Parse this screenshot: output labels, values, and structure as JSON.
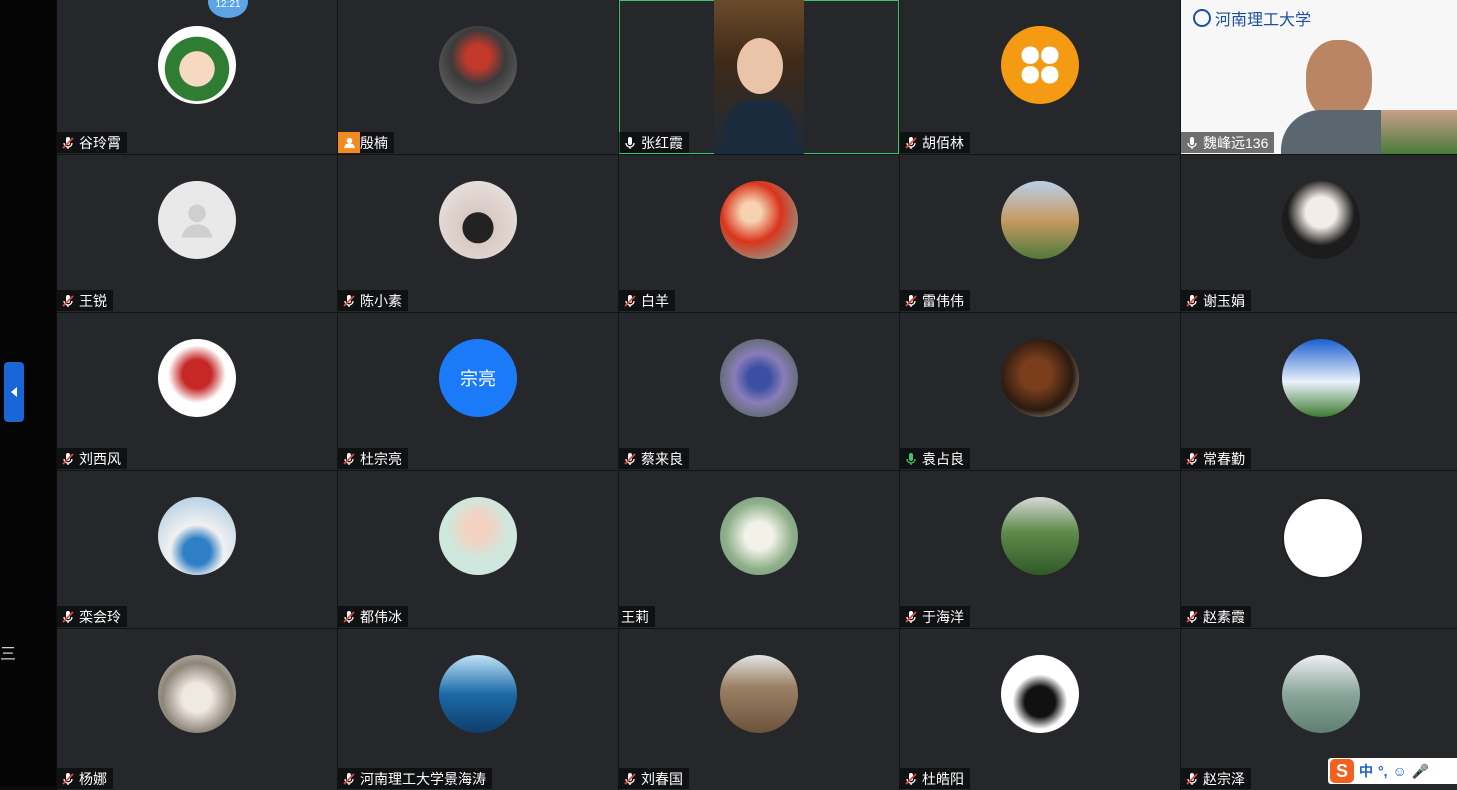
{
  "participants": [
    {
      "name": "谷玲霄",
      "mic": "muted",
      "avatar": "cartoon-girl-avatar",
      "badge_text": "12:21"
    },
    {
      "name": "殷楠",
      "mic": "user-badge",
      "avatar": "boy-photo-avatar"
    },
    {
      "name": "张红霞",
      "mic": "on",
      "avatar": "woman-video-feed"
    },
    {
      "name": "胡佰林",
      "mic": "muted",
      "avatar": "orange-clover-avatar"
    },
    {
      "name": "魏峰远136",
      "mic": "on",
      "avatar": "man-video-feed",
      "banner_text": "河南理工大学"
    },
    {
      "name": "王锐",
      "mic": "muted",
      "avatar": "default-person-avatar"
    },
    {
      "name": "陈小素",
      "mic": "muted",
      "avatar": "moon-ornament-avatar"
    },
    {
      "name": "白羊",
      "mic": "muted",
      "avatar": "red-art-avatar"
    },
    {
      "name": "雷伟伟",
      "mic": "muted",
      "avatar": "castle-landscape-avatar"
    },
    {
      "name": "谢玉娟",
      "mic": "muted",
      "avatar": "sketch-girl-avatar"
    },
    {
      "name": "刘西风",
      "mic": "muted",
      "avatar": "red-robot-avatar"
    },
    {
      "name": "杜宗亮",
      "mic": "muted",
      "avatar": "initials-avatar",
      "initials": "宗亮"
    },
    {
      "name": "蔡来良",
      "mic": "muted",
      "avatar": "flowers-avatar"
    },
    {
      "name": "袁占良",
      "mic": "on-green",
      "avatar": "root-sculpture-avatar"
    },
    {
      "name": "常春勤",
      "mic": "muted",
      "avatar": "sky-clouds-avatar"
    },
    {
      "name": "栾会玲",
      "mic": "muted",
      "avatar": "daisy-vase-avatar"
    },
    {
      "name": "都伟冰",
      "mic": "muted",
      "avatar": "child-photo-avatar"
    },
    {
      "name": "王莉",
      "mic": "none",
      "avatar": "chamomile-avatar"
    },
    {
      "name": "于海洋",
      "mic": "muted",
      "avatar": "farmland-avatar"
    },
    {
      "name": "赵素霞",
      "mic": "muted",
      "avatar": "doodle-girl-avatar"
    },
    {
      "name": "杨娜",
      "mic": "muted",
      "avatar": "hedgehog-avatar"
    },
    {
      "name": "河南理工大学景海涛",
      "mic": "muted",
      "avatar": "sea-coast-avatar"
    },
    {
      "name": "刘春国",
      "mic": "muted",
      "avatar": "rocks-avatar"
    },
    {
      "name": "杜皓阳",
      "mic": "muted",
      "avatar": "black-coat-avatar"
    },
    {
      "name": "赵宗泽",
      "mic": "muted",
      "avatar": "mountain-pavilion-avatar"
    }
  ],
  "sidebar": {
    "menu_glyph": "三"
  },
  "ime": {
    "logo": "S",
    "mode": "中",
    "punct": "°,"
  },
  "colors": {
    "tile_bg": "#25272a",
    "accent_blue": "#1a66d6",
    "active_border": "#3cc46a",
    "muted_red": "#e04a3a"
  }
}
